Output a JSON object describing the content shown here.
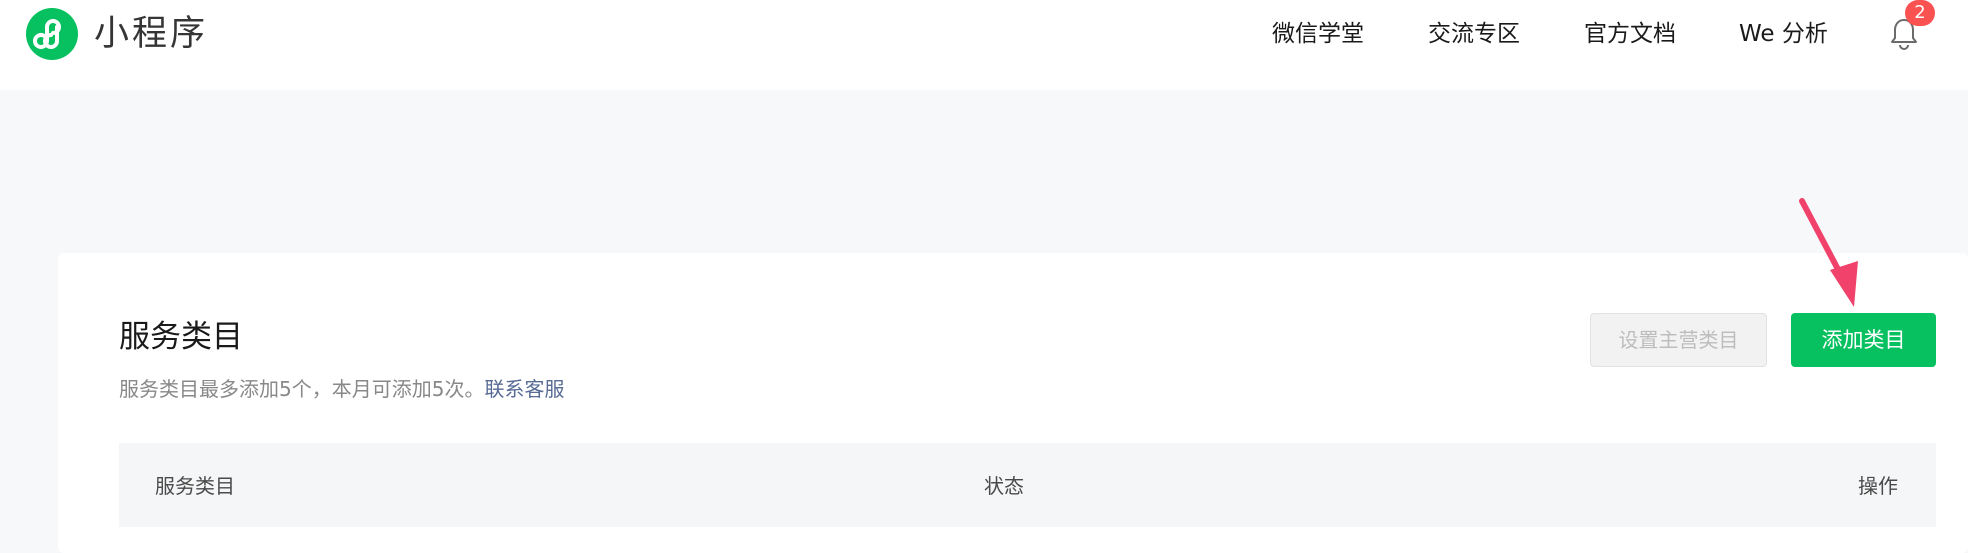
{
  "header": {
    "logo_icon": "mini-program-logo-icon",
    "app_title": "小程序",
    "nav": {
      "item1": "微信学堂",
      "item2": "交流专区",
      "item3": "官方文档",
      "item4": "We 分析"
    },
    "notification_icon": "bell-icon",
    "notification_count": "2"
  },
  "colors": {
    "brand_green": "#07c160",
    "badge_red": "#fa5151",
    "link_blue": "#576b95",
    "annotation_arrow": "#f0426b"
  },
  "main": {
    "title": "服务类目",
    "description": "服务类目最多添加5个，本月可添加5次。",
    "contact_link": "联系客服",
    "set_main_button": "设置主营类目",
    "add_button": "添加类目",
    "table": {
      "columns": {
        "category": "服务类目",
        "status": "状态",
        "actions": "操作"
      }
    }
  }
}
